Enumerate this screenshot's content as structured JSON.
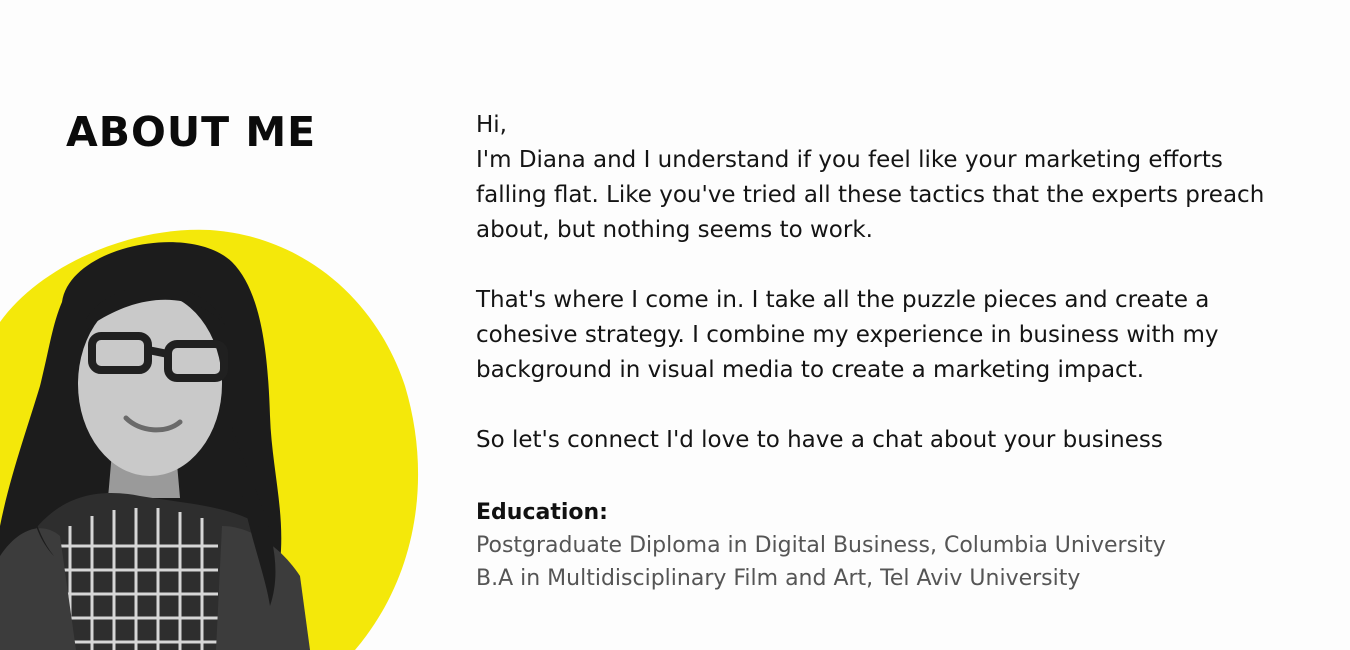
{
  "heading": "ABOUT ME",
  "colors": {
    "accent": "#f4e80a",
    "background": "#fdfdfd",
    "text": "#141414",
    "education_text": "#555555"
  },
  "bio": {
    "greeting": "Hi,",
    "paragraph1": [
      "I'm Diana and I understand if you feel like your marketing efforts",
      "falling flat. Like you've tried all these tactics that the experts preach",
      "about, but nothing seems to work."
    ],
    "paragraph2": [
      "That's where I come in. I take all the puzzle pieces and create a",
      "cohesive strategy. I combine my experience in business with my",
      "background in visual media to create a marketing impact."
    ],
    "paragraph3": [
      "So let's connect I'd love to have a chat about your business"
    ]
  },
  "education": {
    "title": "Education:",
    "items": [
      "Postgraduate Diploma in Digital Business, Columbia University",
      "B.A in Multidisciplinary Film and Art, Tel Aviv University"
    ]
  }
}
